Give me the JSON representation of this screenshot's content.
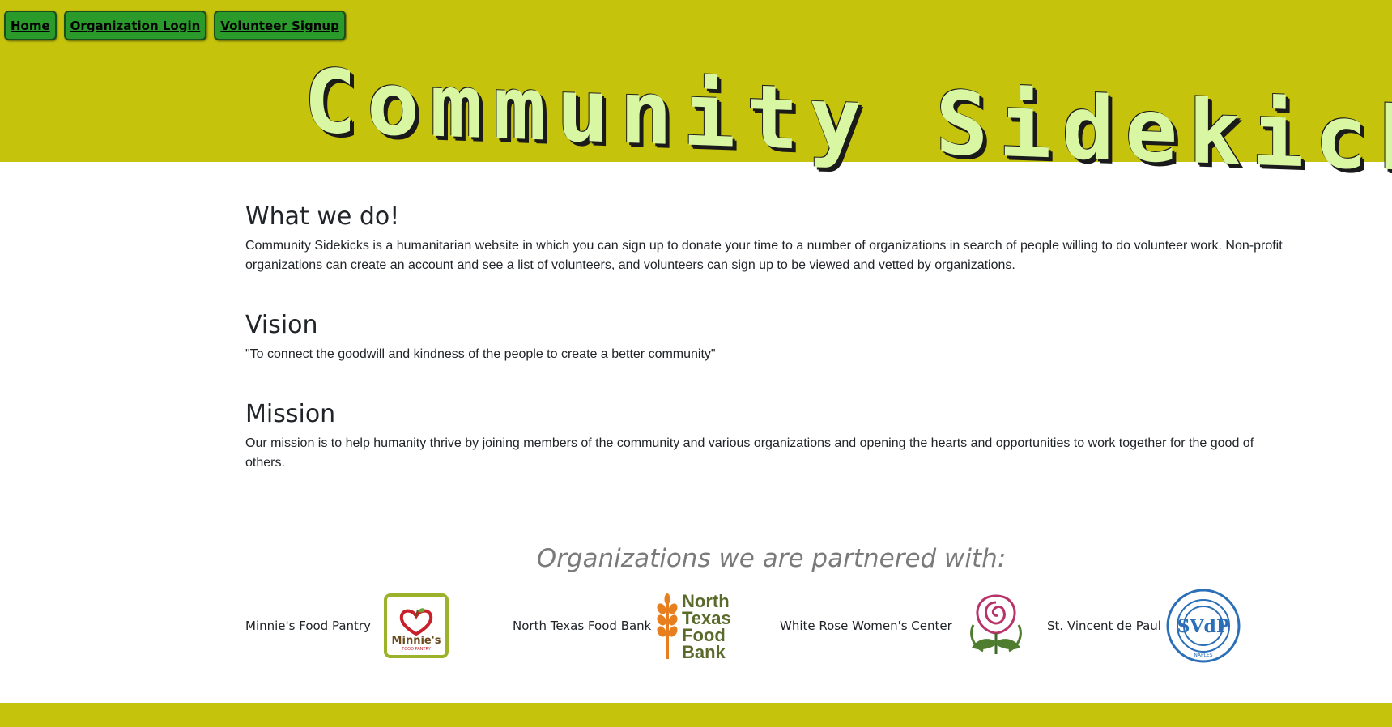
{
  "nav": {
    "home": "Home",
    "org_login": "Organization Login",
    "volunteer_signup": "Volunteer Signup"
  },
  "brand": {
    "title": "Community  Sidekicks"
  },
  "about": {
    "title": "What we do!",
    "text": "Community Sidekicks is a humanitarian website in which you can sign up to donate your time to a number of organizations in search of people willing to do volunteer work. Non-profit organizations can create an account and see a list of volunteers, and volunteers can sign up to be viewed and vetted by organizations."
  },
  "vision": {
    "title": "Vision",
    "text": "\"To connect the goodwill and kindness of the people to create a better community\""
  },
  "mission": {
    "title": "Mission",
    "text": "Our mission is to help humanity thrive by joining members of the community and various organizations and opening the hearts and opportunities to work together for the good of others."
  },
  "partners": {
    "heading": "Organizations we are partnered with:",
    "items": [
      {
        "name": "Minnie's Food Pantry",
        "logo_text": "Minnie's",
        "logo_subtext": "FOOD PANTRY"
      },
      {
        "name": "North Texas Food Bank",
        "logo_lines": [
          "North",
          "Texas",
          "Food",
          "Bank"
        ]
      },
      {
        "name": "White Rose Women's Center"
      },
      {
        "name": "St. Vincent de Paul",
        "logo_text": "SVdP",
        "logo_ring": "SOCIETY of ST. VINCENT DE PAUL",
        "logo_bottom": "NAPLES"
      }
    ]
  },
  "colors": {
    "header_bg": "#c5c30c",
    "button_bg": "#2a9a2a",
    "title_fill": "#d9f7a3",
    "partners_heading": "#7a7a7a"
  }
}
